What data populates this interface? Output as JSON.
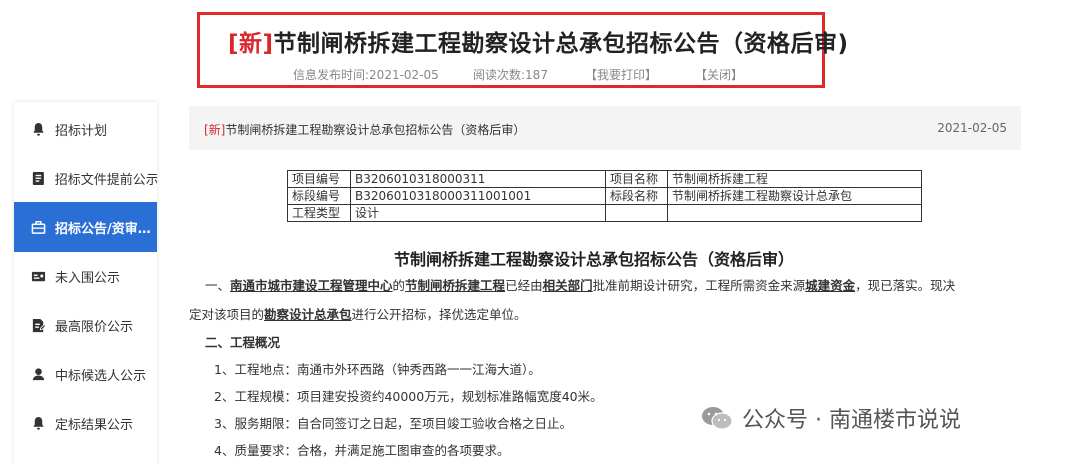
{
  "header": {
    "title_tag": "[新]",
    "title": "节制闸桥拆建工程勘察设计总承包招标公告（资格后审)",
    "publish_time": "信息发布时间:2021-02-05",
    "read_count": "阅读次数:187",
    "print_link": "【我要打印】",
    "close_link": "【关闭】"
  },
  "sidebar": {
    "items": [
      {
        "label": "招标计划",
        "icon": "bell-icon"
      },
      {
        "label": "招标文件提前公示",
        "icon": "document-icon"
      },
      {
        "label": "招标公告/资审…",
        "icon": "briefcase-icon"
      },
      {
        "label": "未入围公示",
        "icon": "id-card-icon"
      },
      {
        "label": "最高限价公示",
        "icon": "file-edit-icon"
      },
      {
        "label": "中标候选人公示",
        "icon": "user-icon"
      },
      {
        "label": "定标结果公示",
        "icon": "bell-icon"
      }
    ]
  },
  "breadcrumb": {
    "tag": "[新]",
    "title": "节制闸桥拆建工程勘察设计总承包招标公告（资格后审）",
    "date": "2021-02-05"
  },
  "info_table": {
    "rows": [
      [
        "项目编号",
        "B3206010318000311",
        "项目名称",
        "节制闸桥拆建工程"
      ],
      [
        "标段编号",
        "B3206010318000311001001",
        "标段名称",
        "节制闸桥拆建工程勘察设计总承包"
      ],
      [
        "工程类型",
        "设计",
        "",
        ""
      ]
    ]
  },
  "doc": {
    "title": "节制闸桥拆建工程勘察设计总承包招标公告（资格后审）",
    "p1_a": "一、",
    "p1_b": "南通市城市建设工程管理中心",
    "p1_c": "的",
    "p1_d": "节制闸桥拆建工程",
    "p1_e": "已经由",
    "p1_f": "相关部门",
    "p1_g": "批准前期设计研究，工程所需资金来源",
    "p1_h": "城建资金",
    "p1_i": "，现已落实。现决",
    "p2_a": "定对该项目的",
    "p2_b": "勘察设计总承包",
    "p2_c": "进行公开招标，择优选定单位。",
    "section2": "二、工程概况",
    "item1": "1、工程地点：南通市外环西路（钟秀西路一一江海大道）。",
    "item2": "2、工程规模：项目建安投资约40000万元，规划标准路幅宽度40米。",
    "item3": "3、服务期限：自合同签订之日起，至项目竣工验收合格之日止。",
    "item4": "4、质量要求：合格，并满足施工图审查的各项要求。"
  },
  "watermark": {
    "text": "公众号 · 南通楼市说说"
  }
}
